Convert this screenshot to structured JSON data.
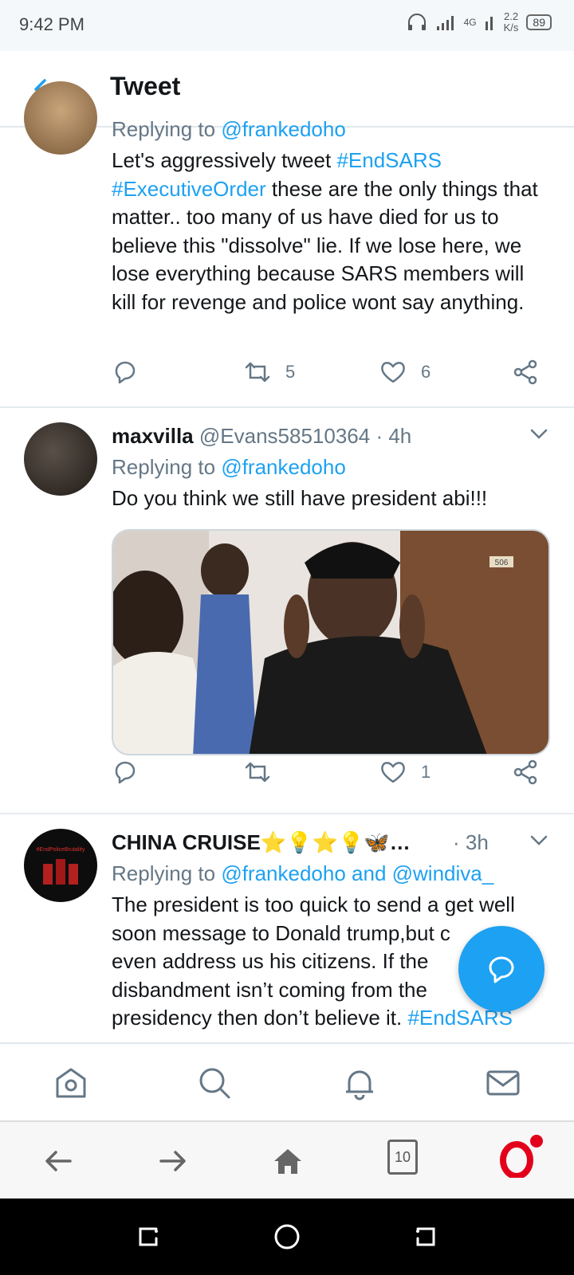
{
  "status": {
    "time": "9:42 PM",
    "network": "4G",
    "speed_value": "2.2",
    "speed_unit": "K/s",
    "battery": "89"
  },
  "header": {
    "title": "Tweet"
  },
  "tweets": [
    {
      "replying_prefix": "Replying to ",
      "mentions": "@frankedoho",
      "text_parts": [
        "Let's aggressively tweet ",
        "#EndSARS",
        " ",
        "#ExecutiveOrder",
        " these are the only things that matter.. too many of us have died for us to believe this \"dissolve\" lie. If we lose here, we lose everything because SARS members will kill for revenge and police wont say anything."
      ],
      "retweets": "5",
      "likes": "6"
    },
    {
      "name": "maxvilla",
      "handle": "@Evans58510364",
      "time": "· 4h",
      "replying_prefix": "Replying to ",
      "mentions": "@frankedoho",
      "text": "Do you think we still have president abi!!!",
      "retweets": "",
      "likes": "1",
      "media_label": "506"
    },
    {
      "name": "CHINA CRUISE⭐💡⭐💡🦋…",
      "time": "· 3h",
      "replying_prefix": "Replying to ",
      "mentions": "@frankedoho and @windiva_",
      "text_parts": [
        "The president is too quick to send a get well soon message to Donald trump,but c",
        "even address us his citizens. If the",
        "disbandment isn’t coming from the",
        "presidency then don’t believe it. ",
        "#EndSARS"
      ],
      "avatar_label": "#EndPoliceBrutality"
    }
  ],
  "icons": {
    "back": "arrow-left-icon",
    "chevron": "chevron-down-icon",
    "reply": "reply-icon",
    "retweet": "retweet-icon",
    "like": "heart-icon",
    "share": "share-icon",
    "compose": "compose-reply-icon",
    "home": "home-icon",
    "search": "search-icon",
    "notifications": "bell-icon",
    "messages": "mail-icon"
  },
  "browser": {
    "tab_count": "10"
  },
  "colors": {
    "accent": "#1da1f2",
    "text": "#14171a",
    "secondary": "#657786",
    "opera": "#e3001b"
  }
}
